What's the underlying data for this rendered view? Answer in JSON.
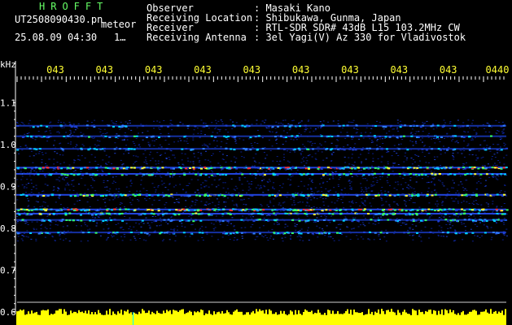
{
  "header": {
    "program": "HROFFT",
    "filename": "UT2508090430.pn",
    "mode": "meteor",
    "date_time": "25.08.09 04:30",
    "page": "1…",
    "fields": [
      {
        "label": "Observer",
        "value": ": Masaki Kano"
      },
      {
        "label": "Receiving Location",
        "value": ": Shibukawa, Gunma, Japan"
      },
      {
        "label": "Receiver",
        "value": ": RTL-SDR SDR# 43dB L15 103.2MHz CW"
      },
      {
        "label": "Receiving Antenna",
        "value": ": 3el Yagi(V) Az 330 for Vladivostok"
      }
    ]
  },
  "chart_data": {
    "type": "heatmap",
    "ylabel": "kHz",
    "y_ticks": [
      "1.1",
      "1.0",
      "0.9",
      "0.8",
      "0.7",
      "0.6"
    ],
    "y_tick_values": [
      1.1,
      1.0,
      0.9,
      0.8,
      0.7,
      0.6
    ],
    "ylim": [
      0.6,
      1.2
    ],
    "x_ticks": [
      "043",
      "043",
      "043",
      "043",
      "043",
      "043",
      "043",
      "043",
      "043",
      "0440"
    ],
    "bands_khz": [
      1.045,
      1.02,
      0.99,
      0.945,
      0.93,
      0.88,
      0.845,
      0.835,
      0.82,
      0.79
    ],
    "band_strength": [
      0.2,
      0.25,
      0.25,
      0.8,
      0.5,
      0.6,
      0.9,
      0.5,
      0.4,
      0.3
    ],
    "colors": {
      "background": "#000000",
      "noise": "#0a1f8c",
      "tick_labels": "#ffff33",
      "signal_bar": "#ffff00",
      "marker": "#00ffff"
    }
  }
}
